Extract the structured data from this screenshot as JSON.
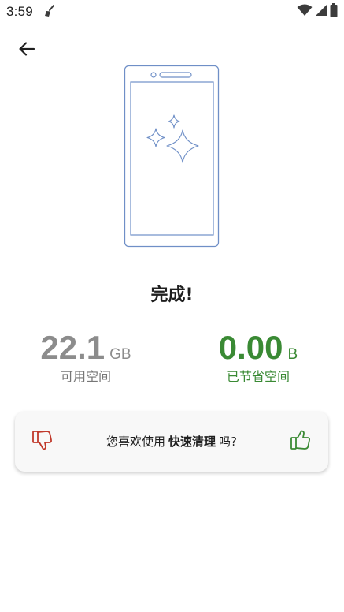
{
  "status_bar": {
    "time": "3:59",
    "icons": [
      "broom-icon",
      "wifi-icon",
      "signal-icon",
      "battery-icon"
    ]
  },
  "header": {
    "back_icon": "arrow-left-icon"
  },
  "illustration": {
    "icon": "phone-sparkles-illustration",
    "stroke_color": "#6f8fc7"
  },
  "result": {
    "title": "完成!"
  },
  "stats": {
    "free": {
      "value": "22.1",
      "unit": "GB",
      "label": "可用空间",
      "color": "#8c8c8c"
    },
    "saved": {
      "value": "0.00",
      "unit": "B",
      "label": "已节省空间",
      "color": "#3a8a34"
    }
  },
  "feedback": {
    "prefix": "您喜欢使用",
    "feature": "快速清理",
    "suffix": "吗?",
    "thumb_down_icon": "thumbs-down-icon",
    "thumb_up_icon": "thumbs-up-icon",
    "down_color": "#c0392b",
    "up_color": "#3a8a34"
  }
}
